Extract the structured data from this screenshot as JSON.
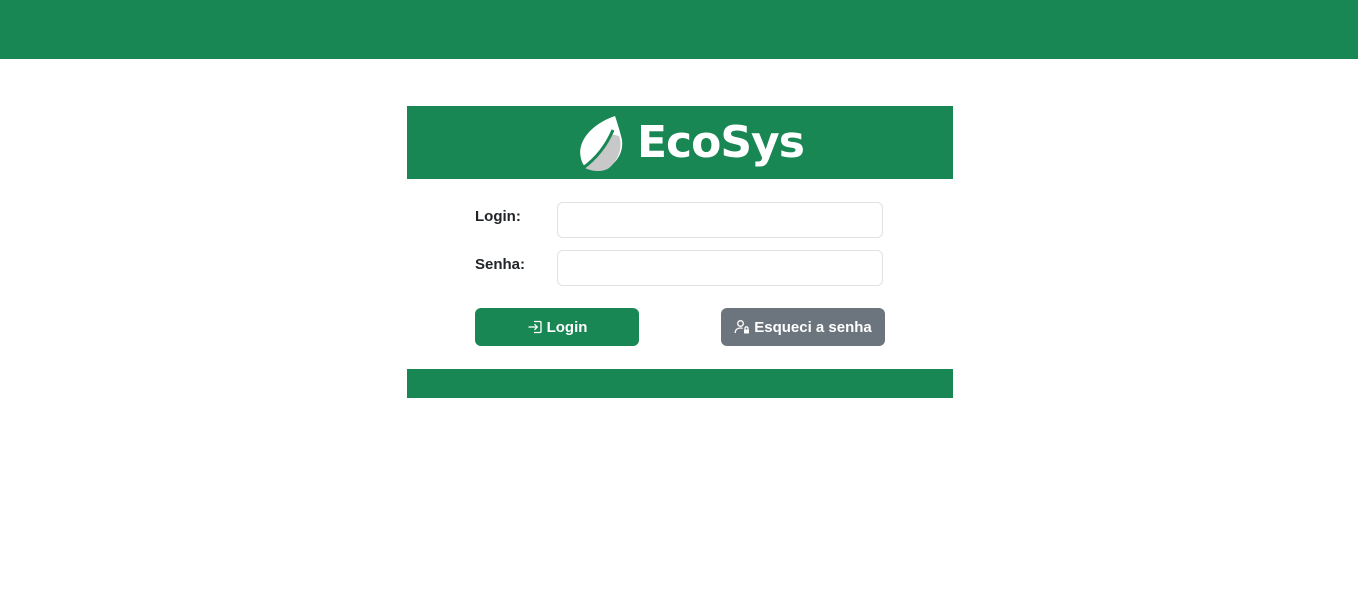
{
  "app": {
    "brand_name": "EcoSys",
    "brand_color": "#198754"
  },
  "form": {
    "login_label": "Login:",
    "login_value": "",
    "password_label": "Senha:",
    "password_value": ""
  },
  "buttons": {
    "login_label": "Login",
    "login_icon": "box-arrow-in-right-icon",
    "forgot_label": "Esqueci a senha",
    "forgot_icon": "person-lock-icon",
    "forgot_color": "#6c757d"
  }
}
